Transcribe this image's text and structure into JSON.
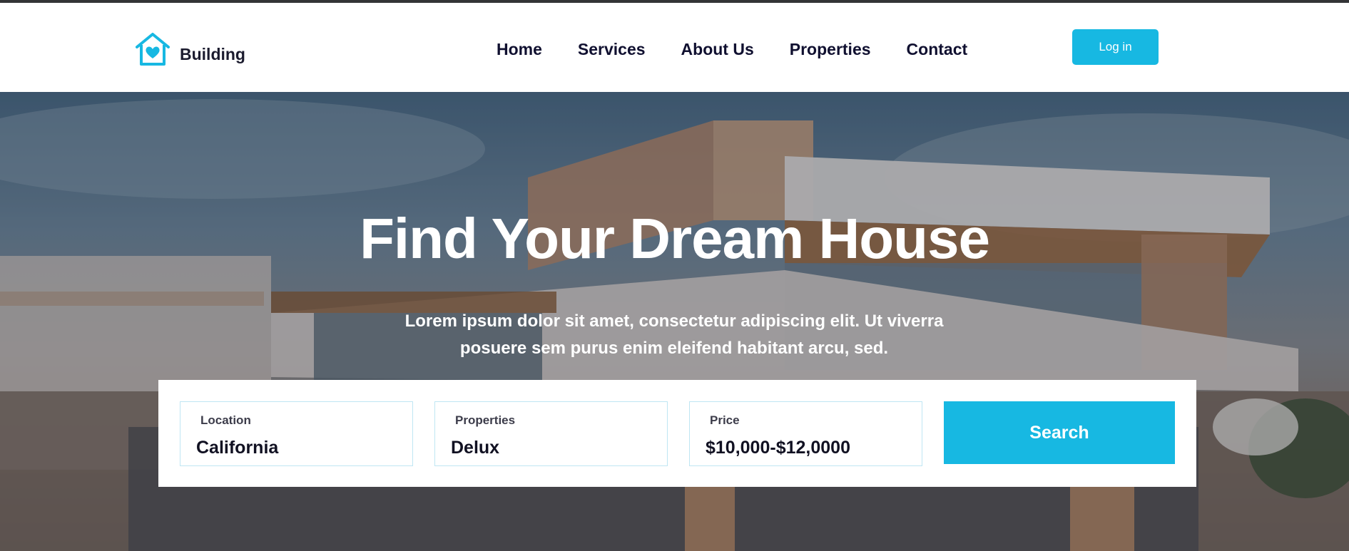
{
  "brand": {
    "name": "Building",
    "accent": "#17b8e2",
    "icon": "house-heart-icon"
  },
  "nav": {
    "items": [
      {
        "label": "Home"
      },
      {
        "label": "Services"
      },
      {
        "label": "About Us"
      },
      {
        "label": "Properties"
      },
      {
        "label": "Contact"
      }
    ],
    "login_label": "Log in"
  },
  "hero": {
    "title": "Find Your Dream House",
    "subtitle": "Lorem ipsum dolor sit amet, consectetur adipiscing elit. Ut viverra posuere sem purus enim eleifend habitant arcu, sed."
  },
  "search": {
    "fields": [
      {
        "label": "Location",
        "value": "California"
      },
      {
        "label": "Properties",
        "value": "Delux"
      },
      {
        "label": "Price",
        "value": "$10,000-$12,0000"
      }
    ],
    "button_label": "Search"
  }
}
